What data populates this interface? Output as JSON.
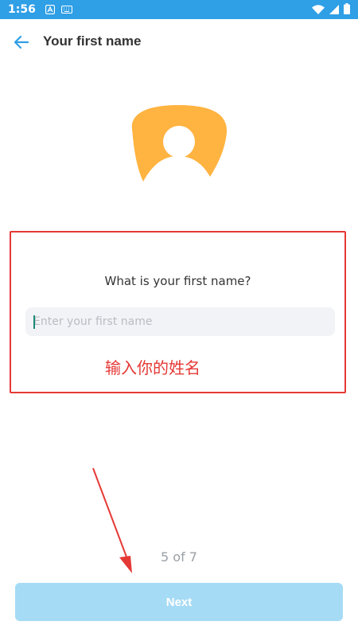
{
  "status_bar": {
    "time": "1:56",
    "icons": [
      "notification-a-icon",
      "keyboard-icon",
      "wifi-icon",
      "cellular-icon",
      "battery-icon"
    ]
  },
  "header": {
    "back_icon": "arrow-left-icon",
    "title": "Your first name"
  },
  "avatar": {
    "icon": "user-avatar-icon",
    "color": "#ffb340"
  },
  "form": {
    "question": "What is your first name?",
    "input_value": "",
    "input_placeholder": "Enter your first name"
  },
  "annotation": {
    "text": "输入你的姓名",
    "color": "#e53935"
  },
  "progress": {
    "step_text": "5 of 7",
    "current": 5,
    "total": 7
  },
  "footer": {
    "next_label": "Next"
  },
  "colors": {
    "accent": "#2f9fe6",
    "button_disabled": "#a6dbf5",
    "annotation_red": "#e53935"
  }
}
